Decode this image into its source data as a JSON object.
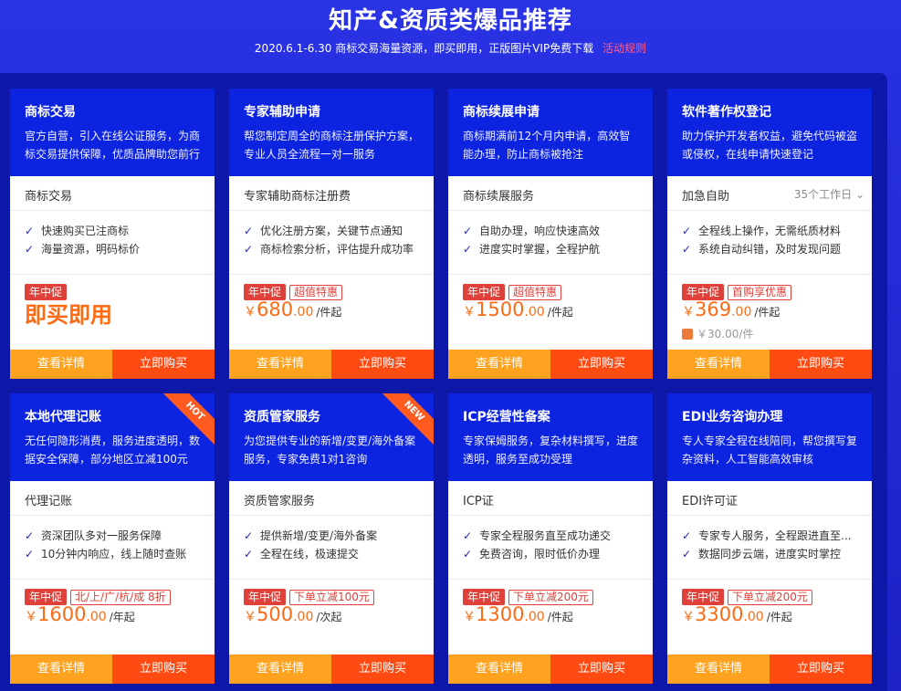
{
  "header": {
    "title": "知产&资质类爆品推荐",
    "subtitle": "2020.6.1-6.30 商标交易海量资源，即买即用，正版图片VIP免费下载",
    "rules_link": "活动规则"
  },
  "buttons": {
    "detail": "查看详情",
    "buy": "立即购买"
  },
  "cards": [
    {
      "title": "商标交易",
      "desc": "官方自营，引入在线公证服务，为商标交易提供保障，优质品牌助您前行",
      "service": "商标交易",
      "features": [
        "快速购买已注商标",
        "海量资源，明码标价"
      ],
      "promo_tag": "年中促",
      "cta": "即买即用"
    },
    {
      "title": "专家辅助申请",
      "desc": "帮您制定周全的商标注册保护方案，专业人员全流程一对一服务",
      "service": "专家辅助商标注册费",
      "features": [
        "优化注册方案，关键节点通知",
        "商标检索分析，评估提升成功率"
      ],
      "promo_tag": "年中促",
      "promo_label": "超值特惠",
      "price_currency": "￥",
      "price_int": "680",
      "price_dec": ".00",
      "price_unit": "/件起"
    },
    {
      "title": "商标续展申请",
      "desc": "商标期满前12个月内申请，高效智能办理，防止商标被抢注",
      "service": "商标续展服务",
      "features": [
        "自助办理，响应快速高效",
        "进度实时掌握，全程护航"
      ],
      "promo_tag": "年中促",
      "promo_label": "超值特惠",
      "price_currency": "￥",
      "price_int": "1500",
      "price_dec": ".00",
      "price_unit": "/件起"
    },
    {
      "title": "软件著作权登记",
      "desc": "助力保护开发者权益，避免代码被盗或侵权，在线申请快速登记",
      "service": "加急自助",
      "service_extra": "35个工作日",
      "features": [
        "全程线上操作，无需纸质材料",
        "系统自动纠错，及时发现问题"
      ],
      "promo_tag": "年中促",
      "promo_label": "首购享优惠",
      "price_currency": "￥",
      "price_int": "369",
      "price_dec": ".00",
      "price_unit": "/件起",
      "orig_price": "￥30.00/件"
    },
    {
      "title": "本地代理记账",
      "desc": "无任何隐形消费，服务进度透明，数据安全保障，部分地区立减100元",
      "service": "代理记账",
      "features": [
        "资深团队多对一服务保障",
        "10分钟内响应，线上随时查账"
      ],
      "promo_tag": "年中促",
      "promo_label": "北/上/广/杭/成 8折",
      "price_currency": "￥",
      "price_int": "1600",
      "price_dec": ".00",
      "price_unit": "/年起",
      "ribbon": "HOT"
    },
    {
      "title": "资质管家服务",
      "desc": "为您提供专业的新增/变更/海外备案服务，专家免费1对1咨询",
      "service": "资质管家服务",
      "features": [
        "提供新增/变更/海外备案",
        "全程在线，极速提交"
      ],
      "promo_tag": "年中促",
      "promo_label": "下单立减100元",
      "price_currency": "￥",
      "price_int": "500",
      "price_dec": ".00",
      "price_unit": "/次起",
      "ribbon": "NEW"
    },
    {
      "title": "ICP经营性备案",
      "desc": "专家保姆服务，复杂材料撰写，进度透明，服务至成功受理",
      "service": "ICP证",
      "features": [
        "专家全程服务直至成功递交",
        "免费咨询，限时低价办理"
      ],
      "promo_tag": "年中促",
      "promo_label": "下单立减200元",
      "price_currency": "￥",
      "price_int": "1300",
      "price_dec": ".00",
      "price_unit": "/件起"
    },
    {
      "title": "EDI业务咨询办理",
      "desc": "专人专家全程在线陪同，帮您撰写复杂资料，人工智能高效审核",
      "service": "EDI许可证",
      "features": [
        "专家专人服务，全程跟进直至...",
        "数据同步云端，进度实时掌控"
      ],
      "promo_tag": "年中促",
      "promo_label": "下单立减200元",
      "price_currency": "￥",
      "price_int": "3300",
      "price_dec": ".00",
      "price_unit": "/件起"
    }
  ]
}
